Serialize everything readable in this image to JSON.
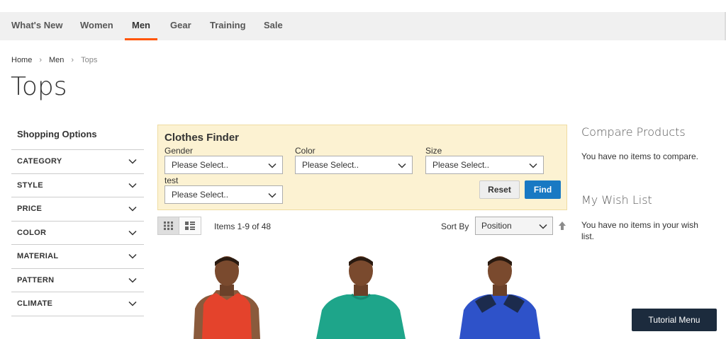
{
  "nav": {
    "items": [
      {
        "label": "What's New"
      },
      {
        "label": "Women"
      },
      {
        "label": "Men",
        "active": true
      },
      {
        "label": "Gear"
      },
      {
        "label": "Training"
      },
      {
        "label": "Sale"
      }
    ],
    "accent_color": "#ff5501"
  },
  "breadcrumb": {
    "items": [
      "Home",
      "Men",
      "Tops"
    ]
  },
  "page": {
    "title": "Tops"
  },
  "sidebar": {
    "title": "Shopping Options",
    "filters": [
      "CATEGORY",
      "STYLE",
      "PRICE",
      "COLOR",
      "MATERIAL",
      "PATTERN",
      "CLIMATE"
    ]
  },
  "finder": {
    "title": "Clothes Finder",
    "fields": [
      {
        "label": "Gender",
        "value": "Please Select.."
      },
      {
        "label": "Color",
        "value": "Please Select.."
      },
      {
        "label": "Size",
        "value": "Please Select.."
      },
      {
        "label": "test",
        "value": "Please Select.."
      }
    ],
    "reset_label": "Reset",
    "find_label": "Find",
    "background_color": "#fcf2d2",
    "find_color": "#1979c3"
  },
  "toolbar": {
    "items_text": "Items 1-9 of 48",
    "sort_label": "Sort By",
    "sort_value": "Position",
    "view_modes": [
      "grid",
      "list"
    ]
  },
  "compare": {
    "title": "Compare Products",
    "text": "You have no items to compare."
  },
  "wishlist": {
    "title": "My Wish List",
    "text": "You have no items in your wish list."
  },
  "products": [
    {
      "shirt_color": "#e4432c"
    },
    {
      "shirt_color": "#1ea58a"
    },
    {
      "shirt_color": "#2e52c9"
    }
  ],
  "tutorial_label": "Tutorial Menu"
}
